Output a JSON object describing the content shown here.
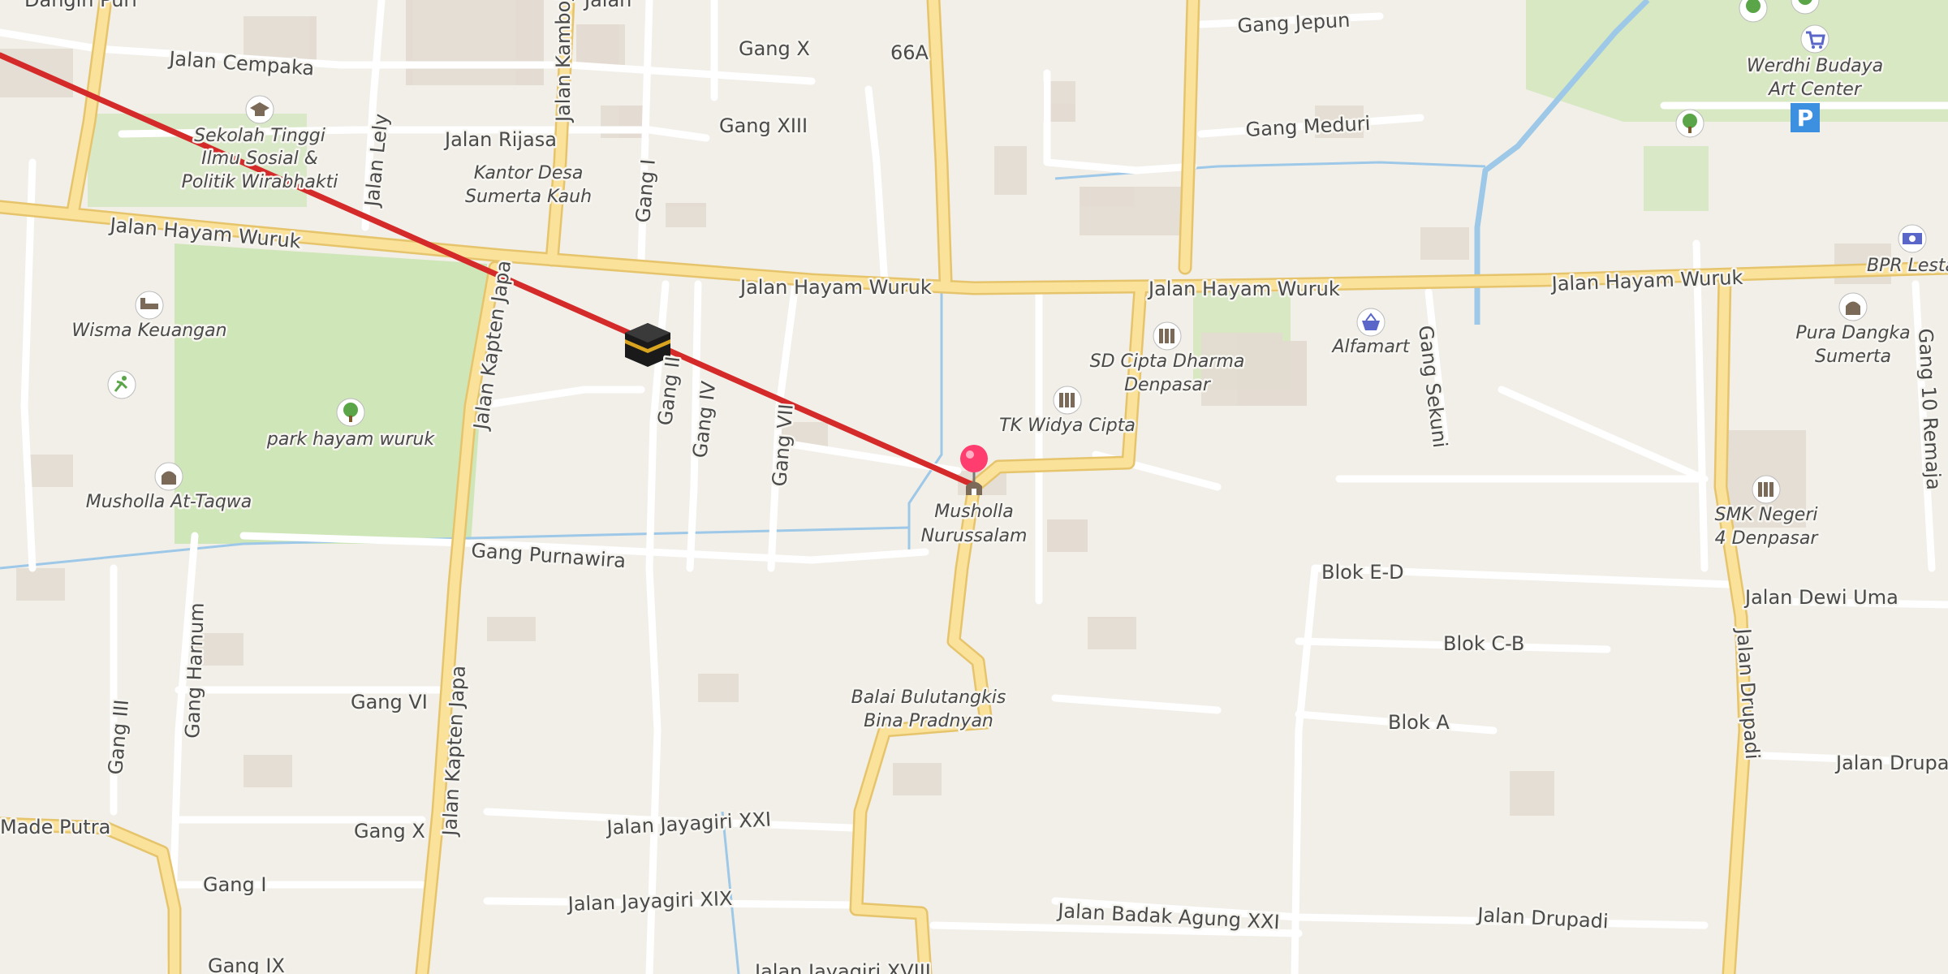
{
  "map": {
    "colors": {
      "background": "#f2efe9",
      "park": "#cfe6b8",
      "building": "#e3dbd1",
      "road_minor": "#ffffff",
      "road_major_fill": "#fbe29a",
      "road_major_casing": "#e6c46c",
      "water": "#9ec8e8",
      "qibla_line": "#d42a2a",
      "pin": "#ff3d6e",
      "poi_icon": "#7b6a58",
      "park_icon": "#5aa548",
      "shop_icon": "#5a67c8",
      "parking": "#3d8fe0"
    },
    "road_labels": {
      "jalan_cempaka": "Jalan Cempaka",
      "jalan_rijasa": "Jalan Rijasa",
      "jalan_lely": "Jalan Lely",
      "jalan_kamboja": "Jalan Kamboja",
      "gang_x_top": "Gang X",
      "gang_66a": "66A",
      "gang_xiii": "Gang XIII",
      "gang_jepun": "Gang Jepun",
      "gang_meduri": "Gang Meduri",
      "gang_i_top": "Gang I",
      "hayam_wuruk_1": "Jalan Hayam Wuruk",
      "hayam_wuruk_2": "Jalan Hayam Wuruk",
      "hayam_wuruk_3": "Jalan Hayam Wuruk",
      "hayam_wuruk_4": "Jalan Hayam Wuruk",
      "kapten_japa_1": "Jalan Kapten Japa",
      "kapten_japa_2": "Jalan Kapten Japa",
      "gang_ii": "Gang II",
      "gang_iv": "Gang IV",
      "gang_vii": "Gang VII",
      "gang_sekuni": "Gang Sekuni",
      "gang_10_remaja": "Gang 10 Remaja",
      "gang_purnawira": "Gang Purnawira",
      "blok_ed": "Blok E-D",
      "blok_cb": "Blok C-B",
      "blok_a": "Blok A",
      "jalan_dewi_uma": "Jalan Dewi Uma",
      "jalan_drupadi_v": "Jalan Drupadi",
      "jalan_drupadi_r": "Jalan Drupadi",
      "jalan_drupadi_b": "Jalan Drupadi",
      "gang_harnum": "Gang Harnum",
      "gang_iii": "Gang III",
      "gang_vi": "Gang VI",
      "gang_x_bottom": "Gang X",
      "gang_i_bottom": "Gang I",
      "gang_ix": "Gang IX",
      "made_putra": "Made Putra",
      "jayagiri_xxi": "Jalan Jayagiri XXI",
      "jayagiri_xix": "Jalan Jayagiri XIX",
      "jayagiri_xviii": "Jalan Jayagiri XVIII",
      "badak_agung_xxi": "Jalan Badak Agung XXI",
      "dangin_puri": "Dangin Puri",
      "jalan_top": "Jalan"
    },
    "pois": {
      "sekolah_tinggi_1": "Sekolah Tinggi",
      "sekolah_tinggi_2": "Ilmu Sosial &",
      "sekolah_tinggi_3": "Politik Wirabhakti",
      "kantor_desa_1": "Kantor Desa",
      "kantor_desa_2": "Sumerta Kauh",
      "wisma_keuangan": "Wisma Keuangan",
      "park_hayam_wuruk": "park hayam wuruk",
      "musholla_at_taqwa": "Musholla At-Taqwa",
      "musholla_nurussalam_1": "Musholla",
      "musholla_nurussalam_2": "Nurussalam",
      "sd_cipta_1": "SD Cipta Dharma",
      "sd_cipta_2": "Denpasar",
      "tk_widya_cipta": "TK Widya Cipta",
      "alfamart": "Alfamart",
      "werdhi_budaya_1": "Werdhi Budaya",
      "werdhi_budaya_2": "Art Center",
      "bpr_lestari": "BPR Lestari",
      "pura_dangka_1": "Pura Dangka",
      "pura_dangka_2": "Sumerta",
      "smk_negeri_1": "SMK Negeri",
      "smk_negeri_2": "4 Denpasar",
      "balai_1": "Balai Bulutangkis",
      "balai_2": "Bina Pradnyan",
      "parking_symbol": "P"
    }
  }
}
